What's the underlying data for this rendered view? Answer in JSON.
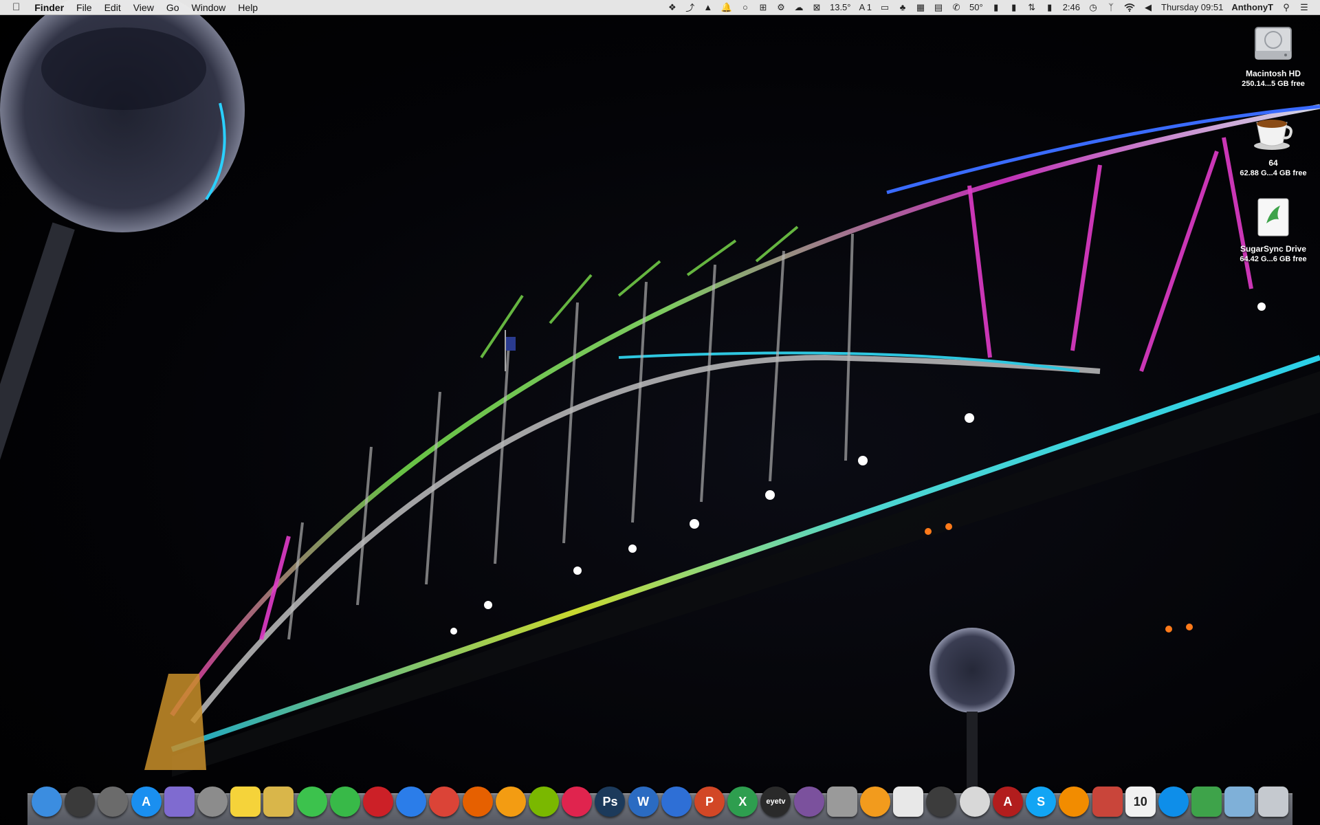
{
  "menubar": {
    "app_name": "Finder",
    "menus": [
      "File",
      "Edit",
      "View",
      "Go",
      "Window",
      "Help"
    ],
    "status": {
      "temperature": "13.5°",
      "font_counter": "1",
      "cpu_temp": "50°",
      "battery_time": "2:46",
      "clock": "Thursday 09:51",
      "user": "AnthonyT"
    }
  },
  "desktop_icons": [
    {
      "name": "Macintosh HD",
      "detail": "250.14...5 GB free",
      "icon": "hard-drive-icon"
    },
    {
      "name": "64",
      "detail": "62.88 G...4 GB free",
      "icon": "coffee-cup-icon"
    },
    {
      "name": "SugarSync Drive",
      "detail": "64.42 G...6 GB free",
      "icon": "sugarsync-icon"
    }
  ],
  "dock": {
    "apps": [
      {
        "icon": "finder-icon",
        "label": "",
        "color": "#3b8de0"
      },
      {
        "icon": "dashboard-icon",
        "label": "",
        "color": "#3a3a3a"
      },
      {
        "icon": "launchpad-icon",
        "label": "",
        "color": "#6b6b6b"
      },
      {
        "icon": "app-store-icon",
        "label": "A",
        "color": "#1a8ff0"
      },
      {
        "icon": "folder-app-icon",
        "label": "",
        "color": "#7f6bd0"
      },
      {
        "icon": "contacts-icon",
        "label": "",
        "color": "#8c8c8c"
      },
      {
        "icon": "notes-icon",
        "label": "",
        "color": "#f5d33a"
      },
      {
        "icon": "preview-icon",
        "label": "",
        "color": "#d9b64a"
      },
      {
        "icon": "messages-icon",
        "label": "",
        "color": "#3cc24d"
      },
      {
        "icon": "facetime-icon",
        "label": "",
        "color": "#38b948"
      },
      {
        "icon": "photo-booth-icon",
        "label": "",
        "color": "#cc2027"
      },
      {
        "icon": "safari-icon",
        "label": "",
        "color": "#2b7de9"
      },
      {
        "icon": "chrome-icon",
        "label": "",
        "color": "#db4437"
      },
      {
        "icon": "firefox-icon",
        "label": "",
        "color": "#e66000"
      },
      {
        "icon": "ibooks-icon",
        "label": "",
        "color": "#f39c12"
      },
      {
        "icon": "spotify-icon",
        "label": "",
        "color": "#7ab800"
      },
      {
        "icon": "itunes-icon",
        "label": "",
        "color": "#e0244e"
      },
      {
        "icon": "photoshop-icon",
        "label": "Ps",
        "color": "#1c3a5b"
      },
      {
        "icon": "word-icon",
        "label": "W",
        "color": "#2b6bc2"
      },
      {
        "icon": "bluetooth-icon",
        "label": "",
        "color": "#2e6fd6"
      },
      {
        "icon": "powerpoint-icon",
        "label": "P",
        "color": "#d24726"
      },
      {
        "icon": "excel-icon",
        "label": "X",
        "color": "#2e9e4f"
      },
      {
        "icon": "eyetv-icon",
        "label": "eyetv",
        "color": "#2a2a2a"
      },
      {
        "icon": "viber-icon",
        "label": "",
        "color": "#7b519d"
      },
      {
        "icon": "iphoto-icon",
        "label": "",
        "color": "#9a9a9a"
      },
      {
        "icon": "pages-icon",
        "label": "",
        "color": "#f29b1d"
      },
      {
        "icon": "script-editor-icon",
        "label": "",
        "color": "#e8e8e8"
      },
      {
        "icon": "steam-icon",
        "label": "",
        "color": "#3c3c3c"
      },
      {
        "icon": "system-monitor-icon",
        "label": "",
        "color": "#d8d8d8"
      },
      {
        "icon": "acrobat-icon",
        "label": "A",
        "color": "#b21d1d"
      },
      {
        "icon": "skype-icon",
        "label": "S",
        "color": "#12a5f4"
      },
      {
        "icon": "vlc-icon",
        "label": "",
        "color": "#f28c00"
      },
      {
        "icon": "parallels-icon",
        "label": "",
        "color": "#c9453a"
      },
      {
        "icon": "calendar-icon",
        "label": "10",
        "color": "#f1f1f1"
      },
      {
        "icon": "teamviewer-icon",
        "label": "",
        "color": "#0e8ee9"
      },
      {
        "icon": "sugarsync-dock-icon",
        "label": "",
        "color": "#3ea34a"
      },
      {
        "icon": "downloads-folder-icon",
        "label": "",
        "color": "#7fb0d8"
      },
      {
        "icon": "trash-icon",
        "label": "",
        "color": "#c5c9cf"
      }
    ]
  }
}
